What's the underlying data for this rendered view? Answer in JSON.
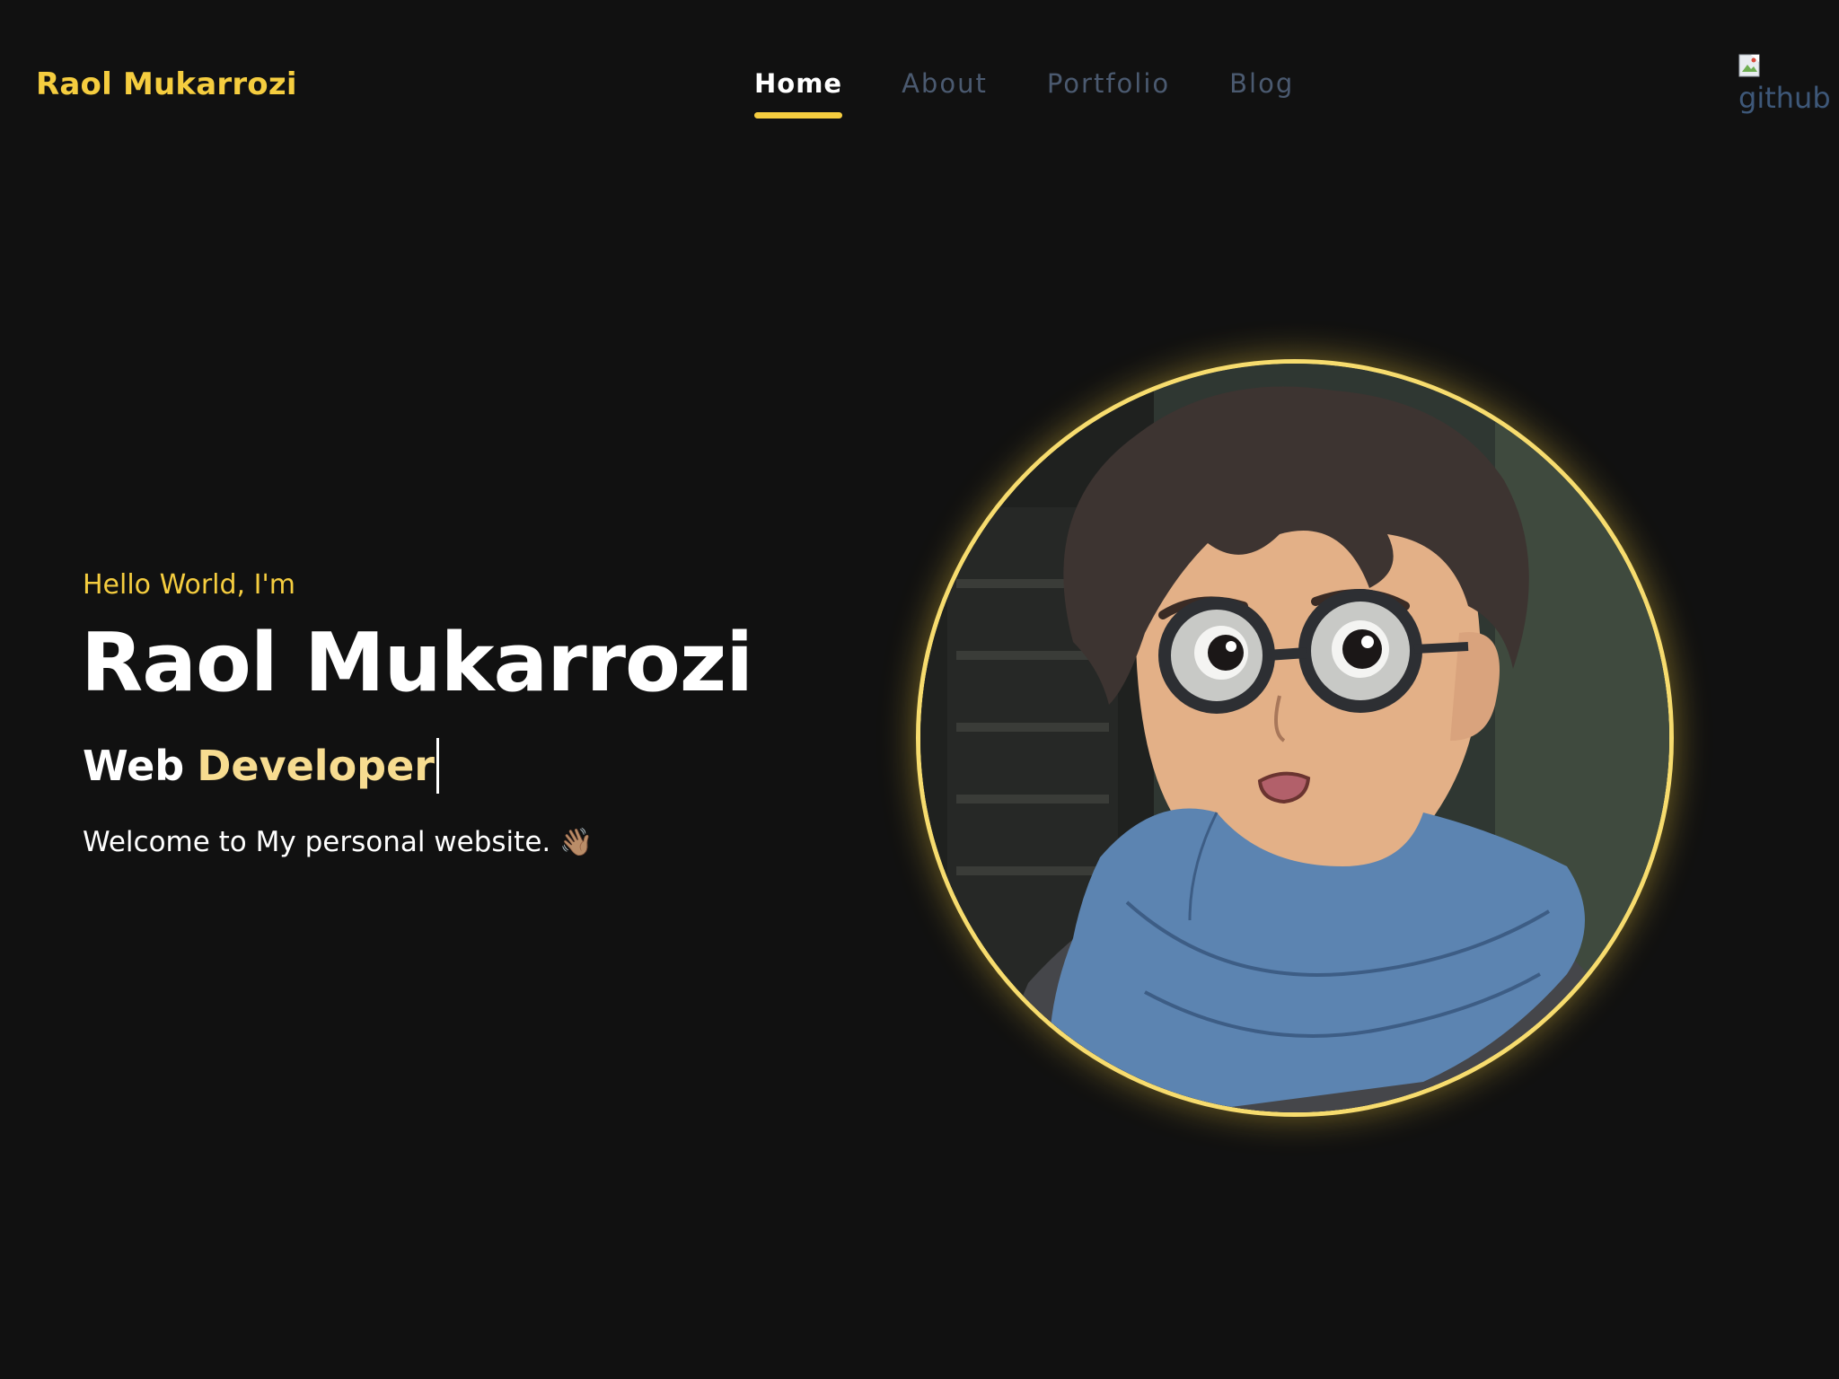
{
  "header": {
    "brand": "Raol Mukarrozi",
    "nav": [
      {
        "label": "Home",
        "active": true
      },
      {
        "label": "About",
        "active": false
      },
      {
        "label": "Portfolio",
        "active": false
      },
      {
        "label": "Blog",
        "active": false
      }
    ],
    "github_alt": "github"
  },
  "hero": {
    "greeting": "Hello World, I'm",
    "name": "Raol Mukarrozi",
    "role_part1": "Web",
    "role_part2": "Developer",
    "welcome": "Welcome to My personal website.",
    "wave_emoji": "👋🏽"
  },
  "colors": {
    "background": "#111111",
    "accent": "#f5cd3f",
    "nav_inactive": "#4b5a70",
    "role_highlight": "#f7dc90"
  },
  "icons": [
    "broken-image-icon",
    "wave-icon"
  ]
}
